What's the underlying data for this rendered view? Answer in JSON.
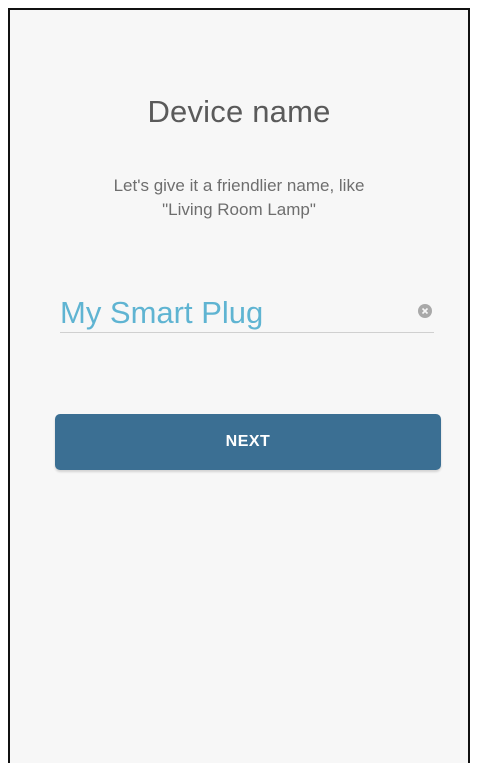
{
  "screen": {
    "title": "Device name",
    "subtitle_line1": "Let's give it a friendlier name, like",
    "subtitle_line2": "\"Living Room Lamp\""
  },
  "name_field": {
    "value": "My Smart Plug",
    "clear_icon": "clear-icon"
  },
  "actions": {
    "next_label": "NEXT"
  },
  "colors": {
    "accent_text": "#5fb4d2",
    "primary_button": "#3b6f93",
    "background": "#f7f7f7"
  }
}
